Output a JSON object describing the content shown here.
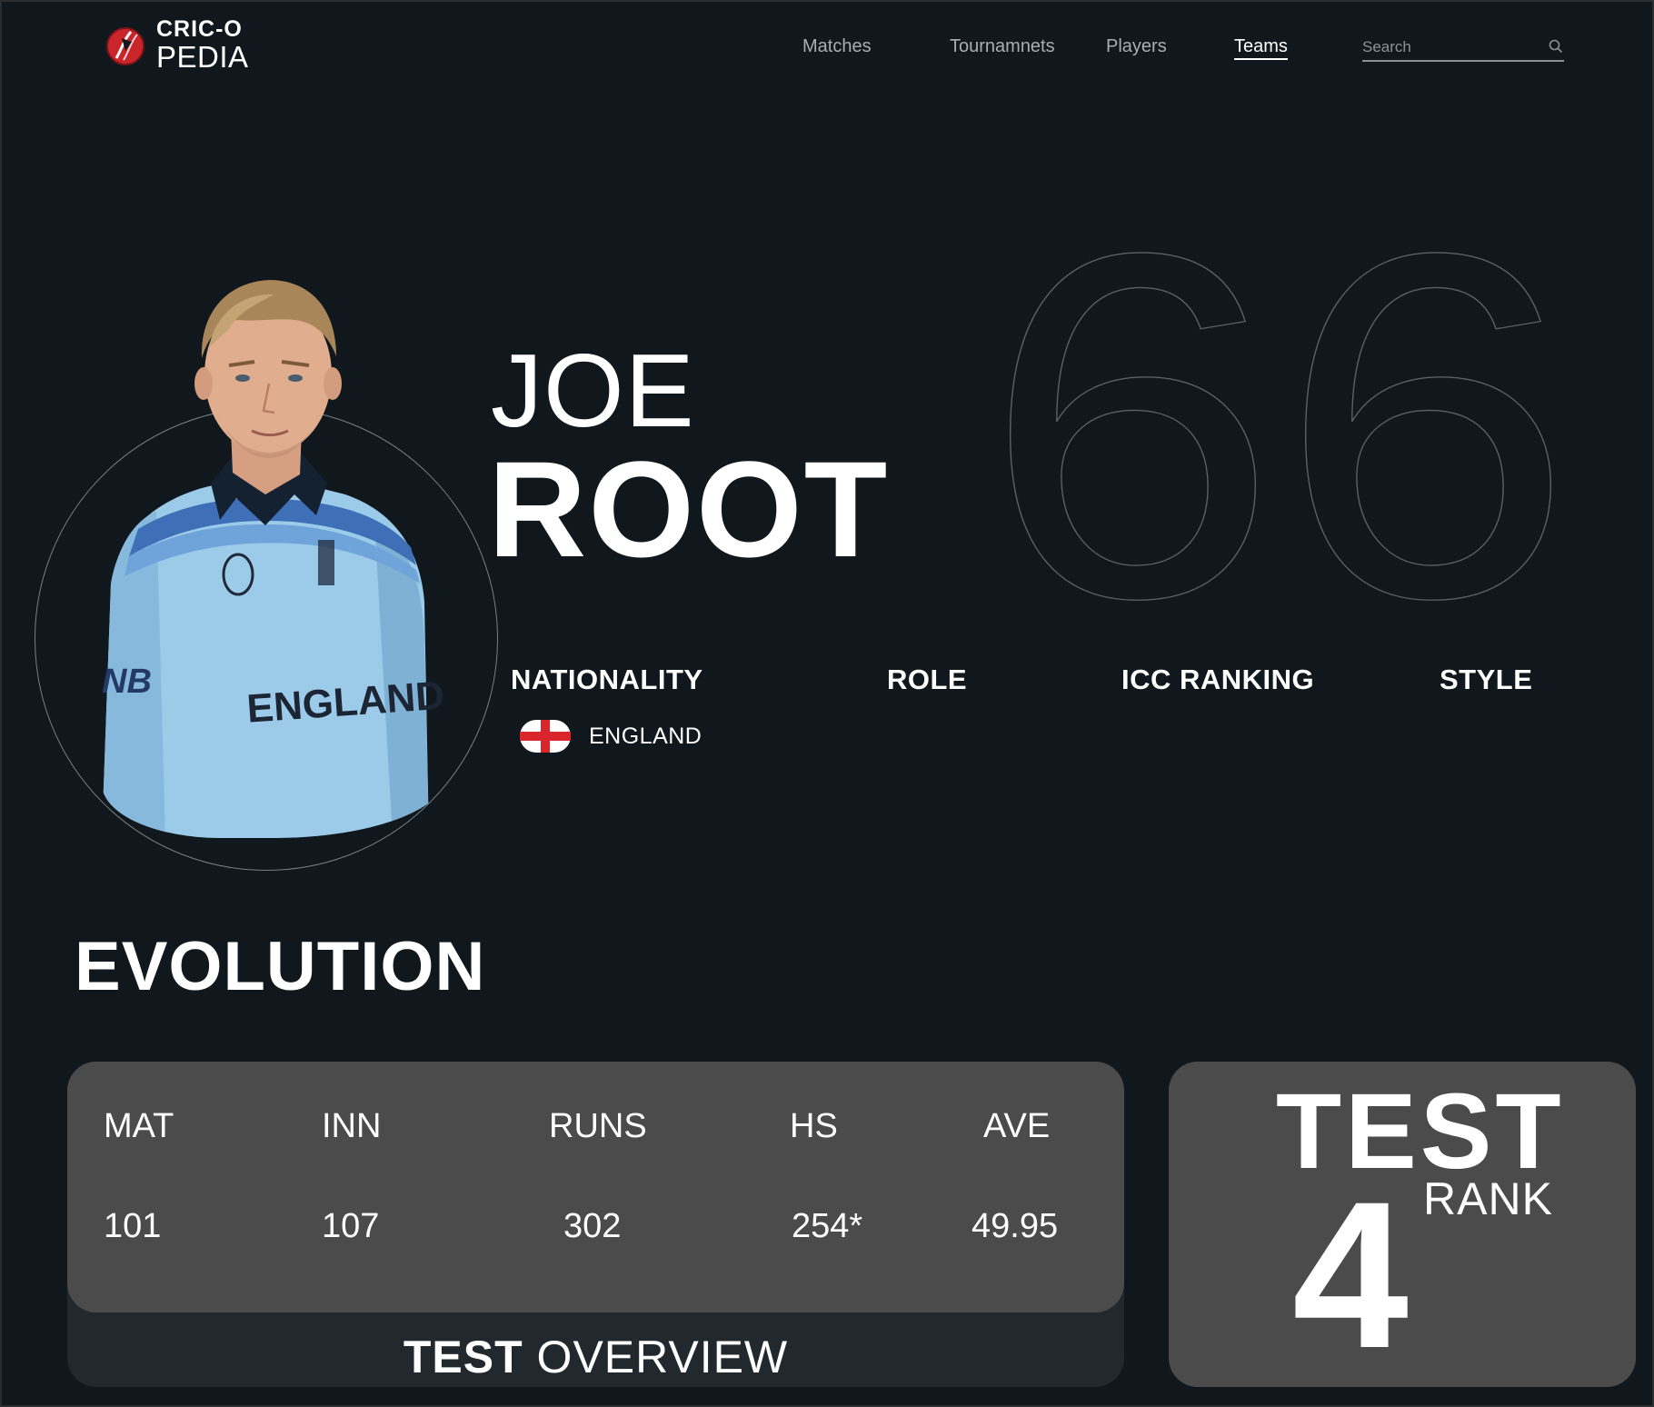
{
  "brand": {
    "line1": "CRIC-O",
    "line2": "PEDIA",
    "accent_color": "#d9262c"
  },
  "nav": {
    "items": [
      {
        "label": "Matches",
        "active": false
      },
      {
        "label": "Tournamnets",
        "active": false
      },
      {
        "label": "Players",
        "active": false
      },
      {
        "label": "Teams",
        "active": true
      }
    ]
  },
  "search": {
    "placeholder": "Search",
    "icon": "search-icon"
  },
  "player": {
    "first_name": "JOE",
    "last_name": "ROOT",
    "jersey_number": "66",
    "photo_icon": "player-photo"
  },
  "attributes": {
    "nationality_label": "NATIONALITY",
    "role_label": "ROLE",
    "icc_ranking_label": "ICC RANKING",
    "style_label": "STYLE",
    "nationality_value": "ENGLAND",
    "flag_icon": "england-flag-icon"
  },
  "evolution": {
    "title": "EVOLUTION",
    "headers": [
      "MAT",
      "INN",
      "RUNS",
      "HS",
      "AVE"
    ],
    "values": [
      "101",
      "107",
      "302",
      "254*",
      "49.95"
    ],
    "overview_bold": "TEST",
    "overview_rest": " OVERVIEW"
  },
  "rank": {
    "format": "TEST",
    "number": "4",
    "label": "RANK"
  }
}
